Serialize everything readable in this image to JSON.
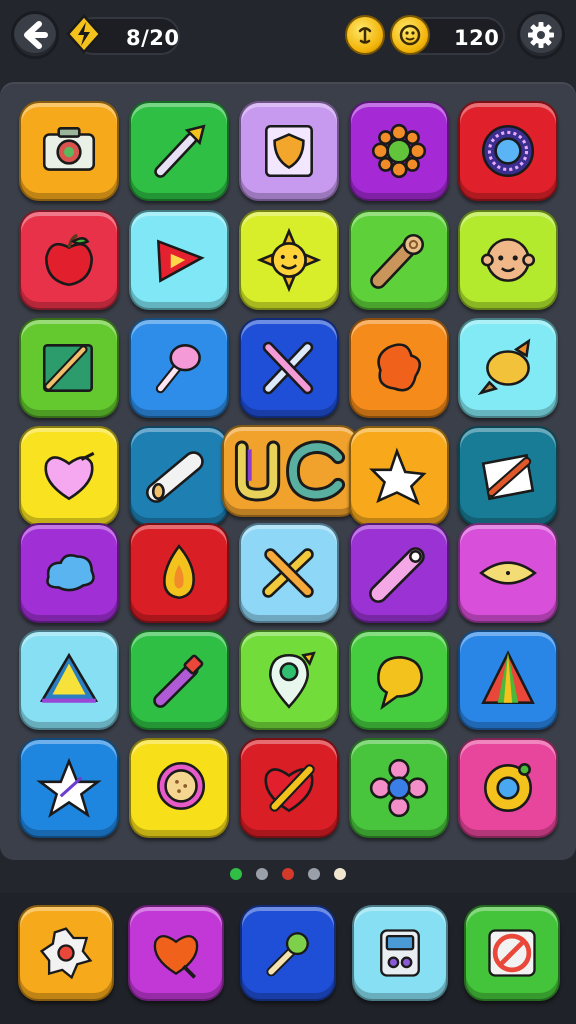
{
  "header": {
    "stars_count": "8/20",
    "coins_count": "120",
    "icons": [
      "back-arrow-icon",
      "lightning-gem-icon",
      "smile-coin-icon",
      "face-coin-icon",
      "gear-icon"
    ]
  },
  "board": {
    "rows": [
      [
        {
          "name": "camera-icon",
          "color": "#f7a91c"
        },
        {
          "name": "pencil-arrow-icon",
          "color": "#2fbf45"
        },
        {
          "name": "shield-card-icon",
          "color": "#c79af0"
        },
        {
          "name": "sun-flower-icon",
          "color": "#a52ad6"
        },
        {
          "name": "round-portal-icon",
          "color": "#e0202a"
        }
      ],
      [
        {
          "name": "apple-icon",
          "color": "#e8324a"
        },
        {
          "name": "play-triangle-icon",
          "color": "#7fe7f5"
        },
        {
          "name": "smiling-sun-icon",
          "color": "#d8ee2a"
        },
        {
          "name": "log-roll-icon",
          "color": "#5ed13a"
        },
        {
          "name": "baby-face-icon",
          "color": "#b3ea2e"
        }
      ],
      [
        {
          "name": "canvas-brush-icon",
          "color": "#63c92f"
        },
        {
          "name": "lollipop-icon",
          "color": "#2d8de8"
        },
        {
          "name": "crossed-brushes-icon",
          "color": "#1f4fd6"
        },
        {
          "name": "paint-blob-icon",
          "color": "#f48b1a"
        },
        {
          "name": "shell-icon",
          "color": "#82eaf4"
        }
      ],
      [
        {
          "name": "heart-ribbon-icon",
          "color": "#f9e21f"
        },
        {
          "name": "scroll-roll-icon",
          "color": "#1e7fb3"
        },
        {
          "name": "uc-letters-icon",
          "color": "#f0a22c"
        },
        {
          "name": "star-splash-icon",
          "color": "#f7a81b"
        },
        {
          "name": "pen-paper-icon",
          "color": "#197c96"
        }
      ],
      [
        {
          "name": "blue-cloud-icon",
          "color": "#a12fd6"
        },
        {
          "name": "flame-icon",
          "color": "#d91e26"
        },
        {
          "name": "crossed-pencils-icon",
          "color": "#8fd7f7"
        },
        {
          "name": "pink-crayon-icon",
          "color": "#9a32d4"
        },
        {
          "name": "eye-shape-icon",
          "color": "#d84fd9"
        }
      ],
      [
        {
          "name": "tent-pyramid-icon",
          "color": "#86dff2"
        },
        {
          "name": "marker-pen-icon",
          "color": "#2fbf45"
        },
        {
          "name": "map-pin-icon",
          "color": "#72dc3a"
        },
        {
          "name": "speech-bubble-icon",
          "color": "#46cc3f"
        },
        {
          "name": "rainbow-cone-icon",
          "color": "#2a86e6"
        }
      ],
      [
        {
          "name": "star-frame-icon",
          "color": "#1f86e0"
        },
        {
          "name": "cookie-bubble-icon",
          "color": "#f7df19"
        },
        {
          "name": "heart-pencil-icon",
          "color": "#d91e26"
        },
        {
          "name": "flower-icon",
          "color": "#48c43d"
        },
        {
          "name": "donut-icon",
          "color": "#e8469c"
        }
      ]
    ]
  },
  "pagination": {
    "pages": 5,
    "active_page": 3,
    "dot_colors": [
      "#2fbf45",
      "#9aa0aa",
      "#d33a2a",
      "#9aa0aa",
      "#f1e6cf"
    ]
  },
  "dock": {
    "items": [
      {
        "name": "gear-flower-icon",
        "color": "#f7a91c"
      },
      {
        "name": "paint-heart-icon",
        "color": "#c238d6"
      },
      {
        "name": "microphone-icon",
        "color": "#1f4fd6"
      },
      {
        "name": "radio-device-icon",
        "color": "#86dff2"
      },
      {
        "name": "no-edit-icon",
        "color": "#44c43a"
      }
    ]
  }
}
